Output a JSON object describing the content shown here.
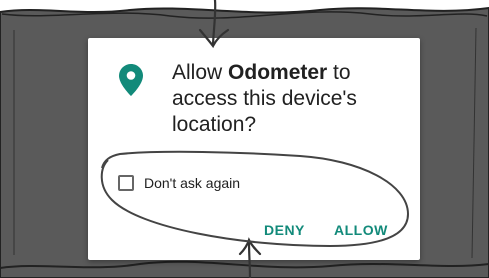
{
  "permission_dialog": {
    "app_name": "Odometer",
    "message_prefix": "Allow ",
    "message_suffix": " to access this device's location?",
    "icon": "location-pin-icon",
    "checkbox_label": "Don't ask again",
    "checkbox_checked": false,
    "deny_label": "DENY",
    "allow_label": "ALLOW"
  },
  "colors": {
    "accent": "#128a7a",
    "backdrop": "#5a5a5a",
    "text": "#212121",
    "annotation_ink": "#333333"
  }
}
